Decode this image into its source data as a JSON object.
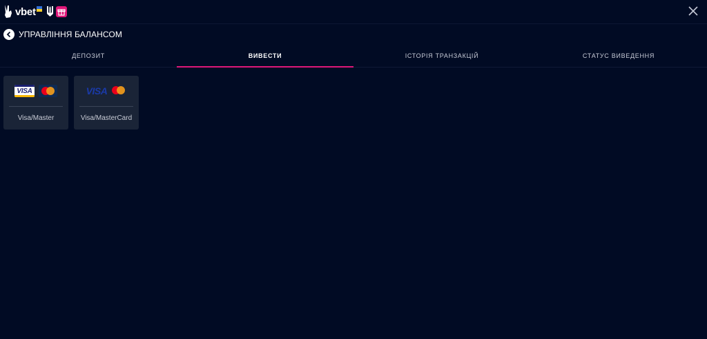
{
  "brand": {
    "name": "vbet",
    "accent_color": "#e0177a"
  },
  "header": {
    "title": "УПРАВЛІННЯ БАЛАНСОМ"
  },
  "tabs": [
    {
      "label": "ДЕПОЗИТ",
      "active": false
    },
    {
      "label": "ВИВЕСТИ",
      "active": true
    },
    {
      "label": "ІСТОРІЯ ТРАНЗАКЦІЙ",
      "active": false
    },
    {
      "label": "СТАТУС ВИВЕДЕННЯ",
      "active": false
    }
  ],
  "payment_methods": [
    {
      "label": "Visa/Master",
      "icons": [
        "visa-logo",
        "mastercard-logo"
      ]
    },
    {
      "label": "Visa/MasterCard",
      "icons": [
        "visa-logo",
        "mastercard-logo"
      ]
    }
  ],
  "icons": {
    "close": "close-icon",
    "back": "chevron-left-icon",
    "gift": "gift-icon"
  }
}
